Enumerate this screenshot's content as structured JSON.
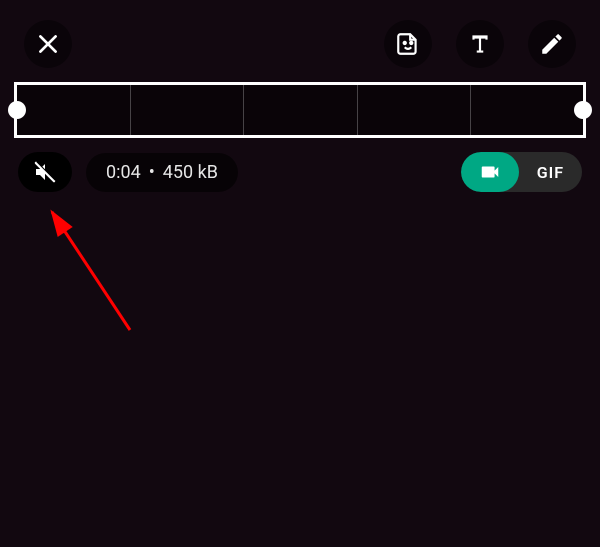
{
  "info": {
    "duration": "0:04",
    "separator": "•",
    "filesize": "450 kB"
  },
  "toggle": {
    "gif_label": "GIF"
  },
  "colors": {
    "accent": "#00a884",
    "annotation": "#ff0000"
  }
}
